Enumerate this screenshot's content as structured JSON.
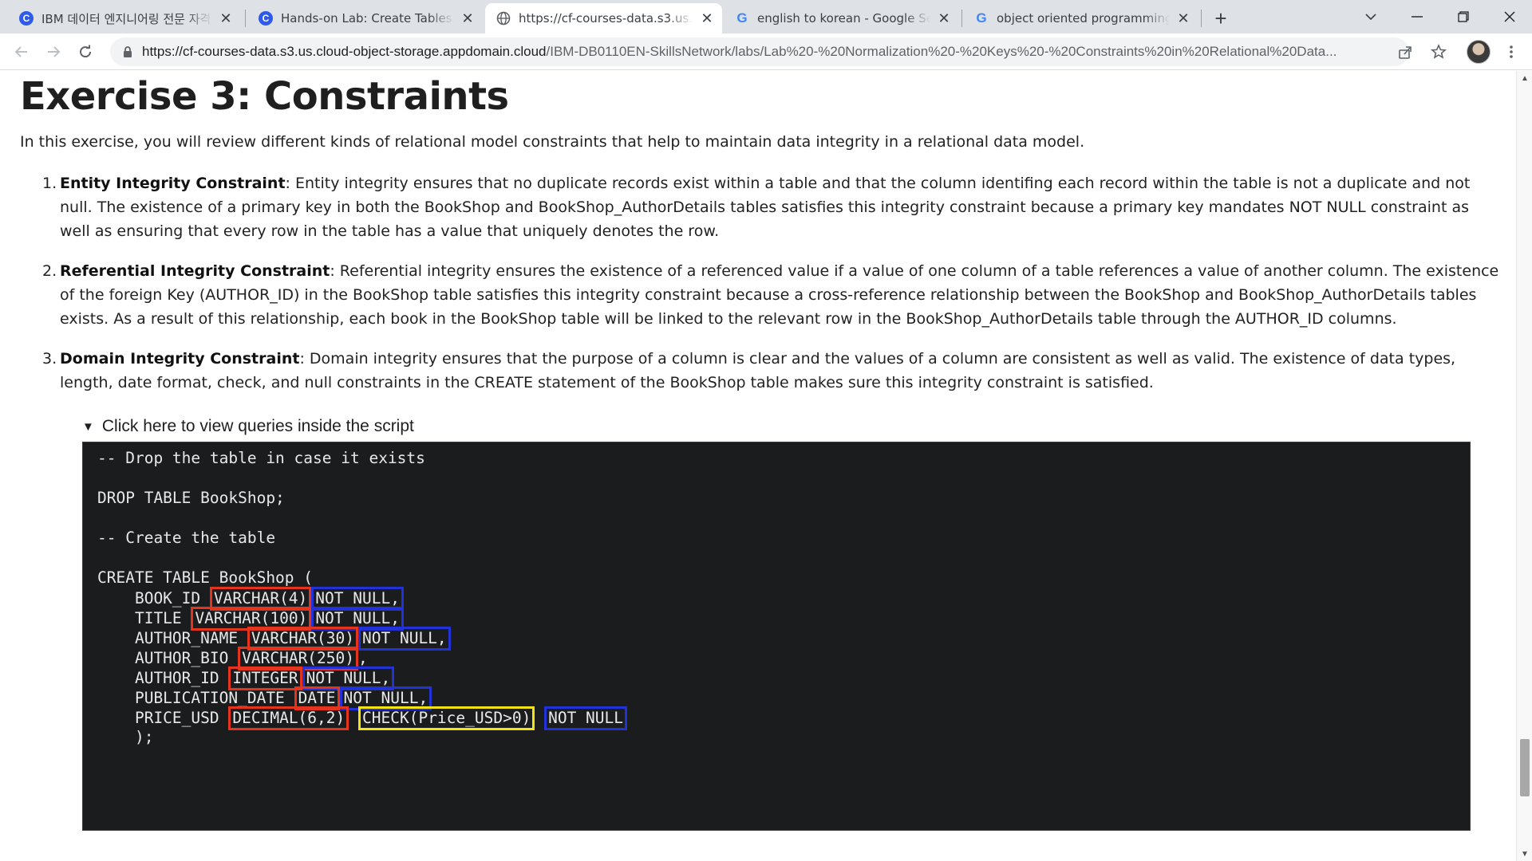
{
  "tabs": [
    {
      "title": "IBM 데이터 엔지니어링 전문 자격증",
      "favicon": "coursera-icon",
      "active": false
    },
    {
      "title": "Hands-on Lab: Create Tables and",
      "favicon": "coursera-icon",
      "active": false
    },
    {
      "title": "https://cf-courses-data.s3.us.cloud",
      "favicon": "globe-icon",
      "active": true
    },
    {
      "title": "english to korean - Google Search",
      "favicon": "google-icon",
      "active": false
    },
    {
      "title": "object oriented programming lang",
      "favicon": "google-icon",
      "active": false
    }
  ],
  "toolbar": {
    "url_domain": "https://cf-courses-data.s3.us.cloud-object-storage.appdomain.cloud",
    "url_path": "/IBM-DB0110EN-SkillsNetwork/labs/Lab%20-%20Normalization%20-%20Keys%20-%20Constraints%20in%20Relational%20Data..."
  },
  "page": {
    "heading": "Exercise 3: Constraints",
    "intro": "In this exercise, you will review different kinds of relational model constraints that help to maintain data integrity in a relational data model.",
    "items": [
      {
        "number": "1.",
        "term": "Entity Integrity Constraint",
        "text": ": Entity integrity ensures that no duplicate records exist within a table and that the column identifing each record within the table is not a duplicate and not null. The existence of a primary key in both the BookShop and BookShop_AuthorDetails tables satisfies this integrity constraint because a primary key mandates NOT NULL constraint as well as ensuring that every row in the table has a value that uniquely denotes the row."
      },
      {
        "number": "2.",
        "term": "Referential Integrity Constraint",
        "text": ": Referential integrity ensures the existence of a referenced value if a value of one column of a table references a value of another column. The existence of the foreign Key (AUTHOR_ID) in the BookShop table satisfies this integrity constraint because a cross-reference relationship between the BookShop and BookShop_AuthorDetails tables exists. As a result of this relationship, each book in the BookShop table will be linked to the relevant row in the BookShop_AuthorDetails table through the AUTHOR_ID columns."
      },
      {
        "number": "3.",
        "term": "Domain Integrity Constraint",
        "text": ": Domain integrity ensures that the purpose of a column is clear and the values of a column are consistent as well as valid. The existence of data types, length, date format, check, and null constraints in the CREATE statement of the BookShop table makes sure this integrity constraint is satisfied."
      }
    ],
    "details_summary": "Click here to view queries inside the script",
    "code": {
      "comment1": "-- Drop the table in case it exists",
      "drop": "DROP TABLE BookShop;",
      "comment2": "-- Create the table",
      "create": "CREATE TABLE BookShop (",
      "close": "    );",
      "columns": [
        {
          "name": "    BOOK_ID",
          "type": "VARCHAR(4)",
          "check": "",
          "nullc": "NOT NULL,"
        },
        {
          "name": "    TITLE",
          "type": "VARCHAR(100)",
          "check": "",
          "nullc": "NOT NULL,"
        },
        {
          "name": "    AUTHOR_NAME",
          "type": "VARCHAR(30)",
          "check": "",
          "nullc": "NOT NULL,"
        },
        {
          "name": "    AUTHOR_BIO",
          "type": "VARCHAR(250)",
          "check": "",
          "nullc": ""
        },
        {
          "name": "    AUTHOR_ID",
          "type": "INTEGER",
          "check": "",
          "nullc": "NOT NULL,"
        },
        {
          "name": "    PUBLICATION_DATE",
          "type": "DATE",
          "check": "",
          "nullc": "NOT NULL,"
        },
        {
          "name": "    PRICE_USD",
          "type": "DECIMAL(6,2)",
          "check": "CHECK(Price_USD>0)",
          "nullc": "NOT NULL"
        }
      ],
      "author_bio_suffix": ","
    }
  },
  "colors": {
    "highlight_type": "#e5341d",
    "highlight_null": "#2332d6",
    "highlight_check": "#f3e216",
    "code_bg": "#1b1c1e"
  }
}
